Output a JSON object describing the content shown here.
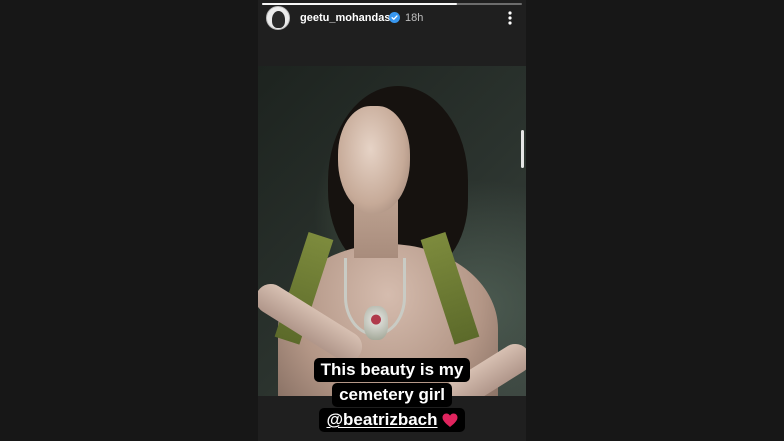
{
  "story": {
    "username": "geetu_mohandas",
    "time_ago": "18h",
    "progress": 0.75,
    "caption_lines": [
      "This beauty is my",
      "cemetery girl"
    ],
    "mention": "@beatrizbach",
    "mention_icon": "heart-emoji",
    "icons": {
      "verified": "verified-badge-icon",
      "more": "more-options-icon"
    }
  },
  "colors": {
    "page_bg": "#171717",
    "text_primary": "#ffffff",
    "text_secondary": "#bdbdbd",
    "caption_bg": "#000000",
    "verified_blue": "#3897f0",
    "heart_red": "#e0245e"
  }
}
